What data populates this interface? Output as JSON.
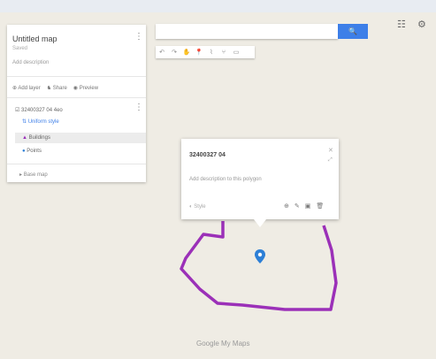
{
  "map": {
    "title": "Untitled map",
    "subtitle": "Saved",
    "description": "Add description",
    "actions": [
      "Add layer",
      "Share",
      "Preview"
    ],
    "layer": {
      "name": "32400327 04 4eo",
      "items": [
        {
          "label": "Uniform style"
        },
        {
          "label": "Buildings"
        },
        {
          "label": "Points"
        }
      ]
    },
    "base_map_label": "Base map",
    "footer": "Google My Maps"
  },
  "search": {
    "button_icon": "search-icon"
  },
  "popup": {
    "title": "32400327 04",
    "description": "Add description to this polygon",
    "style_label": "Style",
    "icons": [
      "add-photo-icon",
      "edit-icon",
      "photo-icon",
      "delete-icon"
    ]
  },
  "colors": {
    "accent": "#3d7fe8",
    "polygon": "#9b30b8",
    "marker": "#2d7fd6",
    "map_bg": "#efece4"
  }
}
